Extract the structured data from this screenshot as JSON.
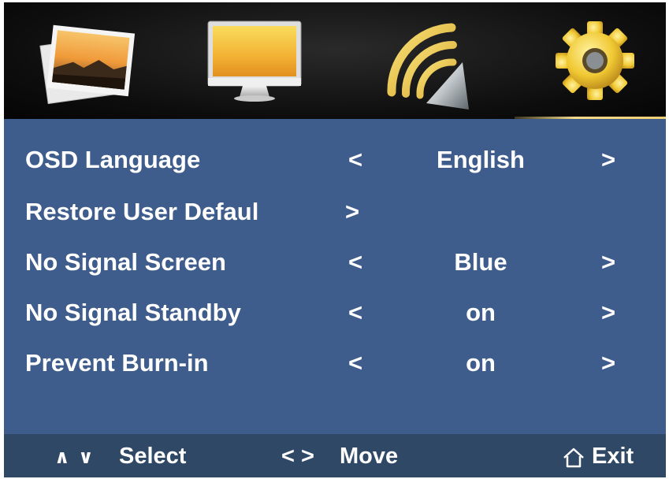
{
  "tabs": [
    {
      "name": "picture",
      "icon": "photo-icon",
      "active": false
    },
    {
      "name": "display",
      "icon": "monitor-icon",
      "active": false
    },
    {
      "name": "audio",
      "icon": "speaker-icon",
      "active": false
    },
    {
      "name": "setup",
      "icon": "gear-icon",
      "active": true
    }
  ],
  "menu": {
    "items": [
      {
        "label": "OSD Language",
        "left_arrow": "<",
        "value": "English",
        "right_arrow": ">"
      },
      {
        "label": "Restore User Defaul",
        "right_arrow": ">"
      },
      {
        "label": "No Signal Screen",
        "left_arrow": "<",
        "value": "Blue",
        "right_arrow": ">"
      },
      {
        "label": "No Signal Standby",
        "left_arrow": "<",
        "value": "on",
        "right_arrow": ">"
      },
      {
        "label": "Prevent Burn-in",
        "left_arrow": "<",
        "value": "on",
        "right_arrow": ">"
      }
    ]
  },
  "footer": {
    "updown_glyph": "∧ ∨",
    "select_label": "Select",
    "move_arrows": "< >",
    "move_label": "Move",
    "exit_label": "Exit"
  },
  "colors": {
    "panel_bg": "#3f5d8c",
    "footer_bg": "#2f4866",
    "tabbar_bg": "#0d0d0d",
    "active_underline": "#f0cf73",
    "text": "#ffffff"
  }
}
